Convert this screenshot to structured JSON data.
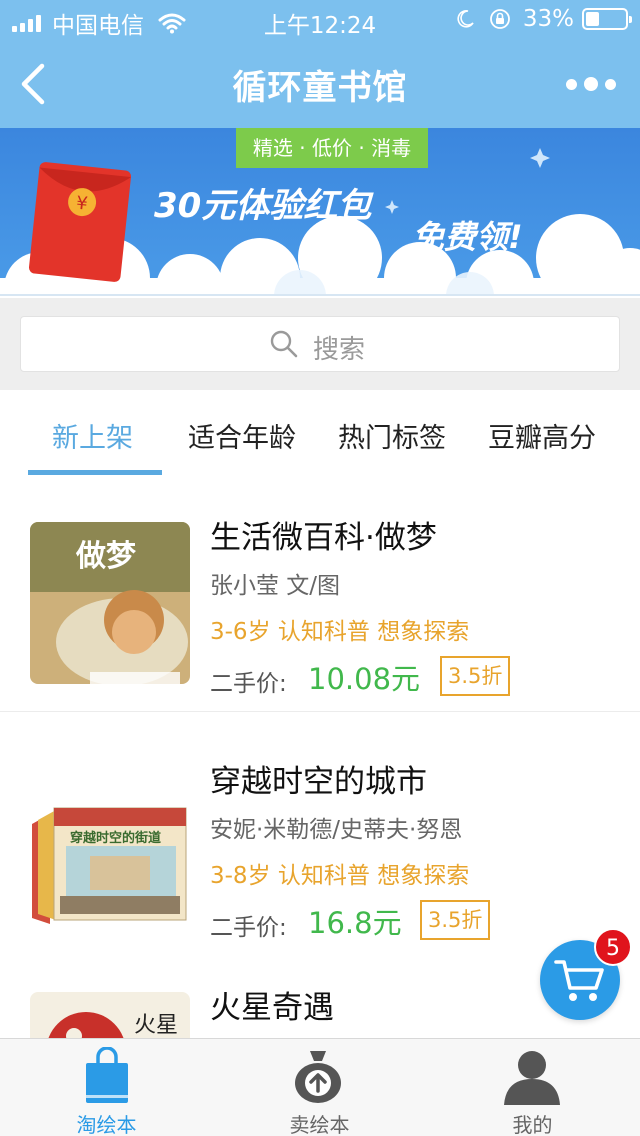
{
  "status_bar": {
    "carrier": "中国电信",
    "time": "上午12:24",
    "battery_percent": "33%",
    "battery_level": 0.33,
    "icons": [
      "signal-icon",
      "wifi-icon",
      "moon-icon",
      "rotation-lock-icon",
      "battery-icon"
    ]
  },
  "nav": {
    "title": "循环童书馆",
    "back_icon": "chevron-left-icon",
    "more_icon": "more-dots-icon"
  },
  "banner": {
    "tag": "精选 · 低价 · 消毒",
    "headline": "30元体验红包",
    "cta": "免费领!",
    "envelope_symbol": "¥"
  },
  "search": {
    "placeholder": "搜索"
  },
  "tabs": [
    {
      "label": "新上架",
      "active": true
    },
    {
      "label": "适合年龄",
      "active": false
    },
    {
      "label": "热门标签",
      "active": false
    },
    {
      "label": "豆瓣高分",
      "active": false
    }
  ],
  "books": [
    {
      "title": "生活微百科·做梦",
      "author": "张小莹 文/图",
      "tags": "3-6岁 认知科普 想象探索",
      "price_label": "二手价:",
      "price": "10.08元",
      "discount": "3.5折",
      "cover_text": "做梦"
    },
    {
      "title": "穿越时空的城市",
      "author": "安妮·米勒德/史蒂夫·努恩",
      "tags": "3-8岁 认知科普 想象探索",
      "price_label": "二手价:",
      "price": "16.8元",
      "discount": "3.5折",
      "cover_text": "穿越时空的街道"
    },
    {
      "title": "火星奇遇",
      "cover_text": "火星"
    }
  ],
  "cart": {
    "count": "5"
  },
  "bottom_nav": [
    {
      "label": "淘绘本",
      "icon": "shopping-bag-icon",
      "active": true
    },
    {
      "label": "卖绘本",
      "icon": "money-bag-upload-icon",
      "active": false
    },
    {
      "label": "我的",
      "icon": "user-icon",
      "active": false
    }
  ],
  "colors": {
    "nav_bg": "#7cc0ee",
    "accent": "#2b9be6",
    "price_green": "#41b84c",
    "tag_orange": "#e8a42d",
    "badge_red": "#e0141c"
  }
}
